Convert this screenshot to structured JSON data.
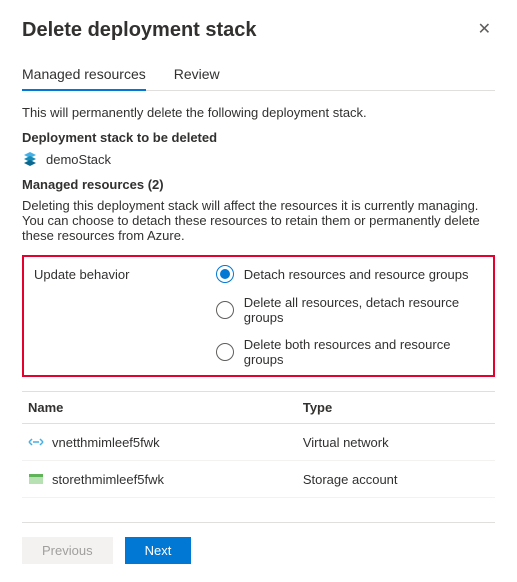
{
  "header": {
    "title": "Delete deployment stack"
  },
  "tabs": [
    {
      "label": "Managed resources",
      "active": true
    },
    {
      "label": "Review",
      "active": false
    }
  ],
  "intro": "This will permanently delete the following deployment stack.",
  "stack_label": "Deployment stack to be deleted",
  "stack_name": "demoStack",
  "managed_label": "Managed resources (2)",
  "managed_desc": "Deleting this deployment stack will affect the resources it is currently managing. You can choose to detach these resources to retain them or permanently delete these resources from Azure.",
  "behavior_label": "Update behavior",
  "behavior_options": [
    {
      "label": "Detach resources and resource groups",
      "checked": true
    },
    {
      "label": "Delete all resources, detach resource groups",
      "checked": false
    },
    {
      "label": "Delete both resources and resource groups",
      "checked": false
    }
  ],
  "table": {
    "headers": {
      "name": "Name",
      "type": "Type"
    },
    "rows": [
      {
        "icon": "vnet",
        "name": "vnetthmimleef5fwk",
        "type": "Virtual network"
      },
      {
        "icon": "storage",
        "name": "storethmimleef5fwk",
        "type": "Storage account"
      }
    ]
  },
  "buttons": {
    "previous": "Previous",
    "next": "Next"
  }
}
